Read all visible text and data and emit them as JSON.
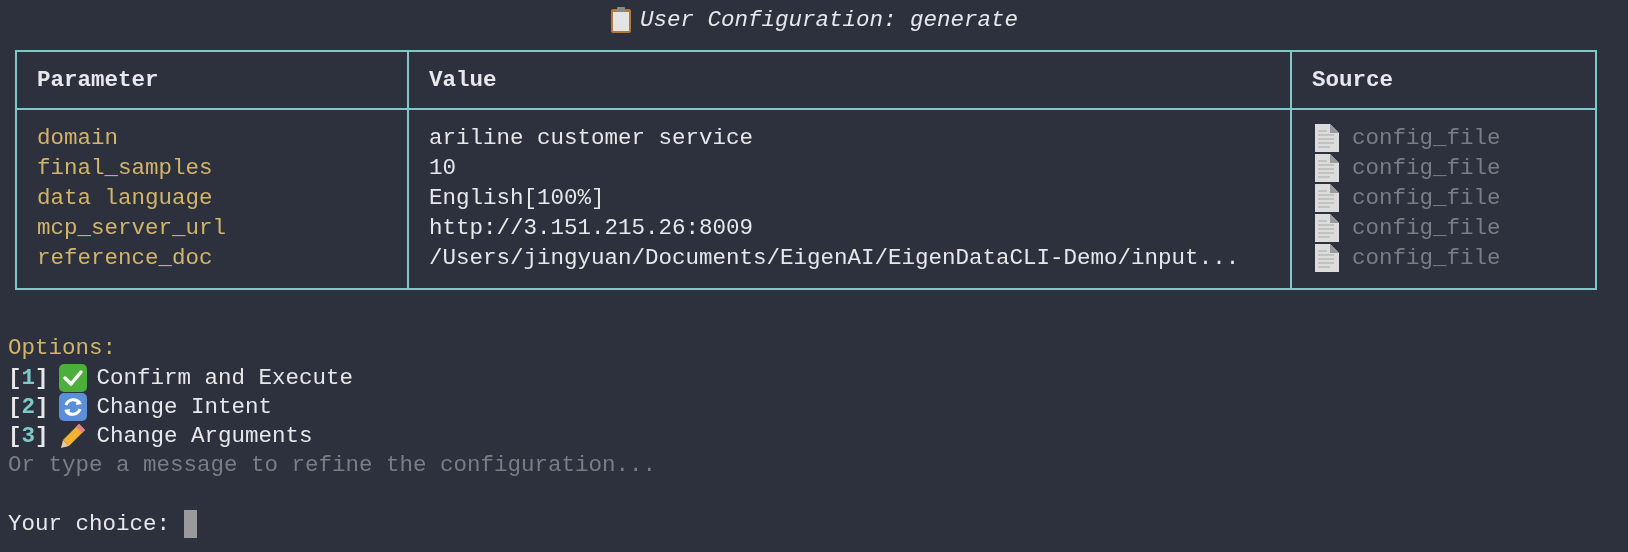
{
  "title": "User Configuration: generate",
  "table": {
    "columns": [
      "Parameter",
      "Value",
      "Source"
    ],
    "rows": [
      {
        "parameter": "domain",
        "value": "ariline customer service",
        "source": "config_file"
      },
      {
        "parameter": "final_samples",
        "value": "10",
        "source": "config_file"
      },
      {
        "parameter": "data language",
        "value": "English[100%]",
        "source": "config_file"
      },
      {
        "parameter": "mcp_server_url",
        "value": "http://3.151.215.26:8009",
        "source": "config_file"
      },
      {
        "parameter": "reference_doc",
        "value": "/Users/jingyuan/Documents/EigenAI/EigenDataCLI-Demo/input...",
        "source": "config_file"
      }
    ]
  },
  "options": {
    "label": "Options:",
    "items": [
      {
        "open": "[",
        "number": "1",
        "close": "]",
        "kind": "check",
        "text": "Confirm and Execute"
      },
      {
        "open": "[",
        "number": "2",
        "close": "]",
        "kind": "refresh",
        "text": "Change Intent"
      },
      {
        "open": "[",
        "number": "3",
        "close": "]",
        "kind": "pencil",
        "text": "Change Arguments"
      }
    ],
    "hint": "Or type a message to refine the configuration..."
  },
  "prompt": {
    "label": "Your choice:"
  }
}
